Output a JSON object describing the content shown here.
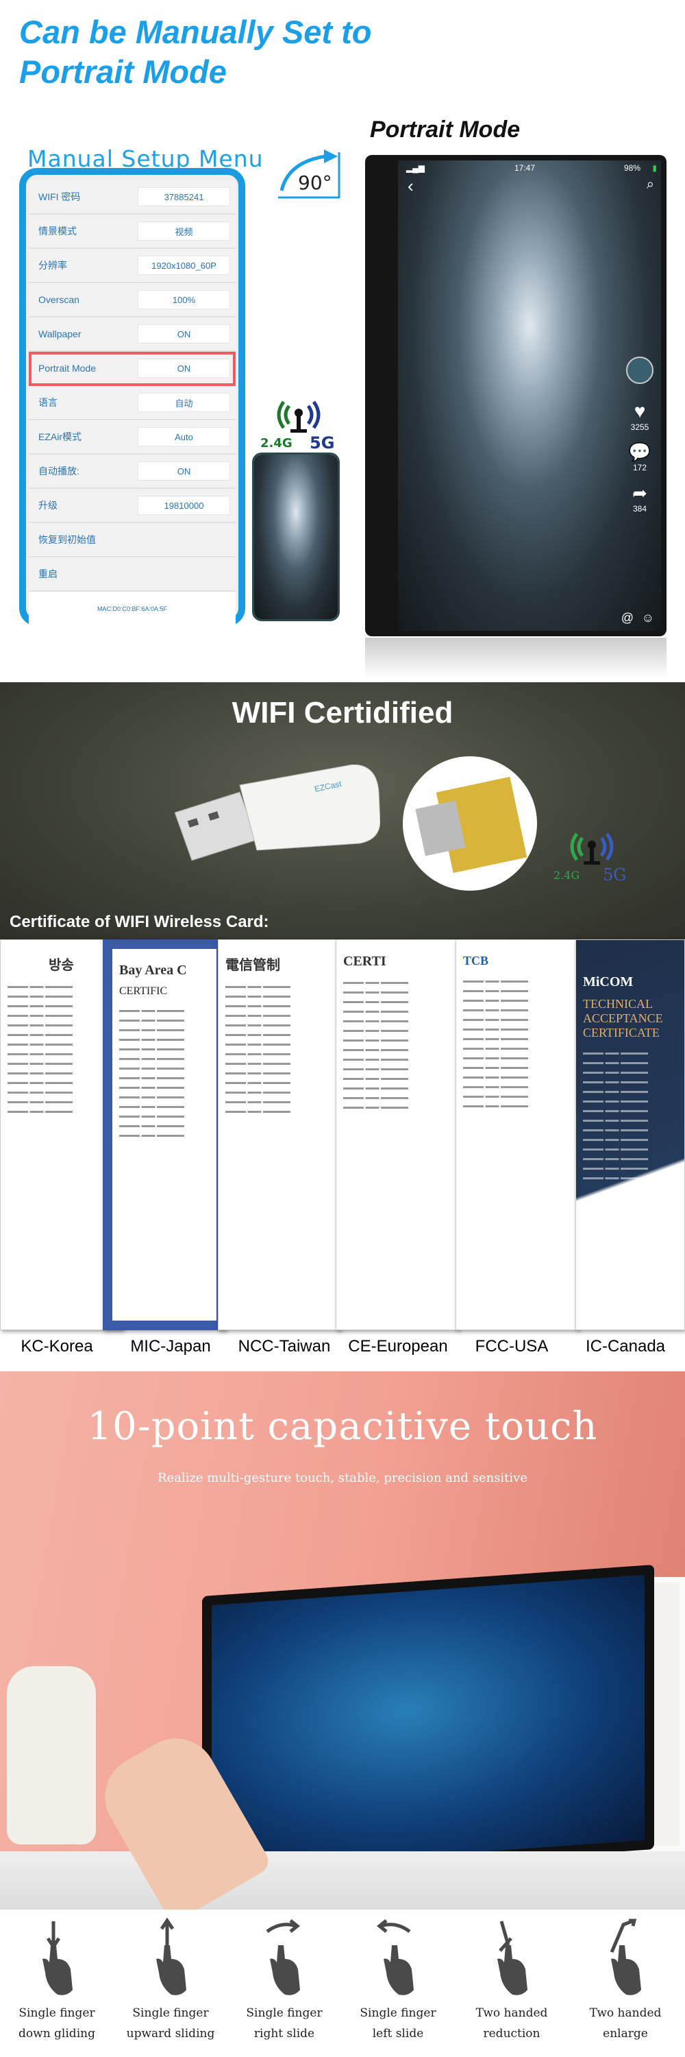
{
  "section1": {
    "title_line1": "Can be Manually Set to",
    "title_line2": "Portrait Mode",
    "menu_heading": "Manual Setup Menu",
    "rotation_label": "90°",
    "menu_rows": [
      {
        "label": "WIFI 密码",
        "value": "37885241"
      },
      {
        "label": "情景模式",
        "value": "视频"
      },
      {
        "label": "分辨率",
        "value": "1920x1080_60P"
      },
      {
        "label": "Overscan",
        "value": "100%"
      },
      {
        "label": "Wallpaper",
        "value": "ON"
      },
      {
        "label": "Portrait Mode",
        "value": "ON",
        "highlighted": true
      },
      {
        "label": "语言",
        "value": "自动"
      },
      {
        "label": "EZAir模式",
        "value": "Auto"
      },
      {
        "label": "自动播放:",
        "value": "ON"
      },
      {
        "label": "升级",
        "value": "19810000"
      },
      {
        "label": "恢复到初始值"
      },
      {
        "label": "重启"
      }
    ],
    "mac": "MAC:D0:C0:BF:6A:0A:5F",
    "wifi_bands": {
      "low": "2.4G",
      "high": "5G"
    },
    "portrait_heading": "Portrait Mode",
    "screen": {
      "time": "17:47",
      "battery": "98%",
      "likes": "3255",
      "comments": "172",
      "shares": "384"
    },
    "highlight_color": "#ef5b62",
    "accent_color": "#1b9fe9"
  },
  "section2": {
    "title": "WIFI Certidified",
    "dongle_brand": "EZCast",
    "wifi_bands": {
      "low": "2.4G",
      "high": "5G"
    },
    "cert_heading": "Certificate of WIFI Wireless Card:",
    "certificates": [
      {
        "label": "KC-Korea",
        "header": "방송"
      },
      {
        "label": "MIC-Japan",
        "header": "Bay Area C",
        "sub": "CERTIFIC"
      },
      {
        "label": "NCC-Taiwan",
        "header": "電信管制"
      },
      {
        "label": "CE-European",
        "header": "CERTI"
      },
      {
        "label": "FCC-USA",
        "header": "TCB"
      },
      {
        "label": "IC-Canada",
        "header": "MiCOM",
        "sub": "TECHNICAL ACCEPTANCE CERTIFICATE"
      }
    ]
  },
  "section3": {
    "title": "10-point capacitive touch",
    "subtitle": "Realize multi-gesture touch, stable, precision and sensitive"
  },
  "gestures": [
    {
      "line1": "Single finger",
      "line2": "down gliding",
      "icon": "hand-swipe-down-icon"
    },
    {
      "line1": "Single finger",
      "line2": "upward sliding",
      "icon": "hand-swipe-up-icon"
    },
    {
      "line1": "Single finger",
      "line2": "right slide",
      "icon": "hand-swipe-right-icon"
    },
    {
      "line1": "Single finger",
      "line2": "left slide",
      "icon": "hand-swipe-left-icon"
    },
    {
      "line1": "Two handed",
      "line2": "reduction",
      "icon": "hand-pinch-icon"
    },
    {
      "line1": "Two handed",
      "line2": "enlarge",
      "icon": "hand-spread-icon"
    }
  ]
}
